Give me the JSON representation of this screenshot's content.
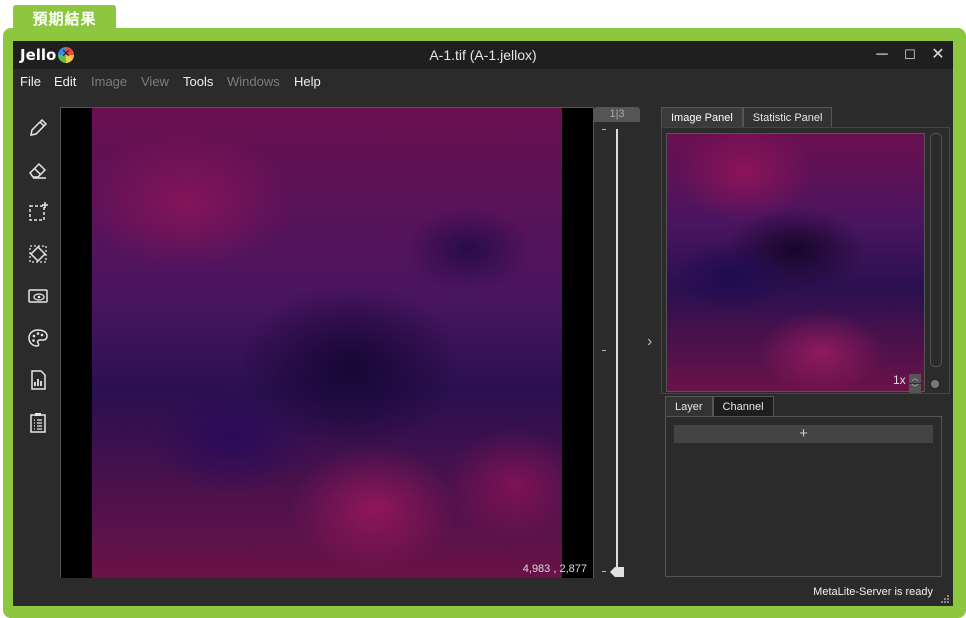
{
  "banner": {
    "label": "預期結果"
  },
  "window": {
    "app_name": "Jello",
    "title": "A-1.tif (A-1.jellox)",
    "controls": {
      "minimize": "─",
      "maximize": "☐",
      "close": "✕"
    }
  },
  "menu": [
    {
      "label": "File",
      "enabled": true
    },
    {
      "label": "Edit",
      "enabled": true
    },
    {
      "label": "Image",
      "enabled": false
    },
    {
      "label": "View",
      "enabled": false
    },
    {
      "label": "Tools",
      "enabled": true
    },
    {
      "label": "Windows",
      "enabled": false
    },
    {
      "label": "Help",
      "enabled": true
    }
  ],
  "toolbar": {
    "tools": [
      "pencil-icon",
      "eraser-icon",
      "select-add-icon",
      "select-transform-icon",
      "eye-view-icon",
      "palette-icon",
      "report-chart-icon",
      "clipboard-list-icon"
    ]
  },
  "viewer": {
    "coordinates": "4,983 , 2,877"
  },
  "slice_slider": {
    "indicator": "1|3",
    "current": 1,
    "total": 3,
    "tick_mark": "-"
  },
  "collapse_toggle": {
    "symbol": "›"
  },
  "right_panel": {
    "tabs": [
      {
        "label": "Image Panel",
        "active": true
      },
      {
        "label": "Statistic Panel",
        "active": false
      }
    ],
    "zoom": "1x",
    "zoom_up": "︿",
    "zoom_down": "﹀",
    "lower_tabs": [
      {
        "label": "Layer",
        "active": false
      },
      {
        "label": "Channel",
        "active": true
      }
    ],
    "add_button": "+"
  },
  "status": {
    "text": "MetaLite-Server is ready"
  },
  "colors": {
    "accent_green": "#8dc63f",
    "window_bg": "#2b2b2b",
    "titlebar_bg": "#1f1f1f"
  }
}
